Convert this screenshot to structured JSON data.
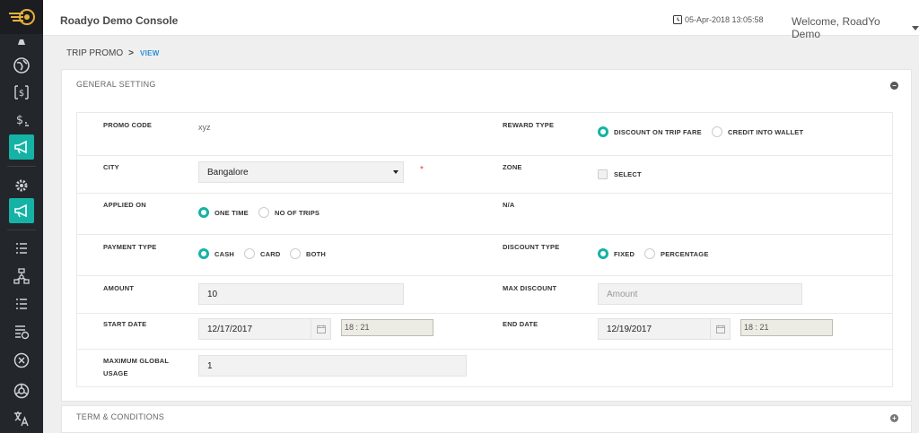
{
  "header": {
    "app_title": "Roadyo Demo Console",
    "datetime": "05-Apr-2018 13:05:58",
    "welcome": "Welcome, RoadYo Demo"
  },
  "breadcrumb": {
    "section": "TRIP PROMO",
    "separator": ">",
    "action": "VIEW"
  },
  "general": {
    "title": "GENERAL SETTING",
    "toggle": "−",
    "promo_code": {
      "label": "PROMO CODE",
      "value": "xyz"
    },
    "reward_type": {
      "label": "REWARD TYPE",
      "options": [
        "DISCOUNT ON TRIP FARE",
        "CREDIT INTO WALLET"
      ],
      "selected": "DISCOUNT ON TRIP FARE"
    },
    "city": {
      "label": "CITY",
      "value": "Bangalore",
      "required_mark": "*"
    },
    "zone": {
      "label": "ZONE",
      "checkbox_label": "SELECT"
    },
    "applied_on": {
      "label": "APPLIED ON",
      "options": [
        "ONE TIME",
        "NO OF TRIPS"
      ],
      "selected": "ONE TIME"
    },
    "na": {
      "label": "N/A"
    },
    "payment_type": {
      "label": "PAYMENT TYPE",
      "options": [
        "CASH",
        "CARD",
        "BOTH"
      ],
      "selected": "CASH"
    },
    "discount_type": {
      "label": "DISCOUNT TYPE",
      "options": [
        "FIXED",
        "PERCENTAGE"
      ],
      "selected": "FIXED"
    },
    "amount": {
      "label": "AMOUNT",
      "value": "10"
    },
    "max_discount": {
      "label": "MAX DISCOUNT",
      "placeholder": "Amount"
    },
    "start_date": {
      "label": "START DATE",
      "date": "12/17/2017",
      "time": "18 : 21"
    },
    "end_date": {
      "label": "END DATE",
      "date": "12/19/2017",
      "time": "18 : 21"
    },
    "max_global_usage": {
      "label_line1": "MAXIMUM GLOBAL",
      "label_line2": "USAGE",
      "value": "1"
    }
  },
  "terms": {
    "title": "TERM & CONDITIONS",
    "toggle": "+"
  },
  "colors": {
    "accent": "#15b3a6",
    "sidebar": "#23262b",
    "link": "#2c8fd6",
    "required": "#e53935"
  },
  "sidebar_icons": [
    "logo-icon",
    "globe-icon",
    "fare-icon",
    "dollar-icon",
    "megaphone-icon",
    "gear-icon",
    "megaphone-icon",
    "list-icon",
    "network-icon",
    "list-icon",
    "report-icon",
    "cancel-icon",
    "reels-icon",
    "translate-icon"
  ]
}
